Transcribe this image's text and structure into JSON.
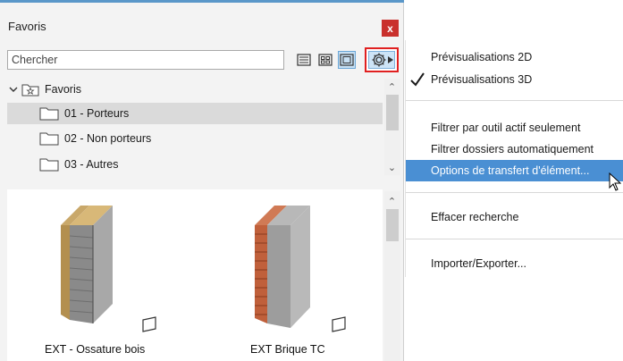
{
  "panel": {
    "title": "Favoris",
    "close_label": "x",
    "search": {
      "placeholder": "Chercher",
      "value": "Chercher"
    }
  },
  "tree": {
    "root": "Favoris",
    "folders": [
      {
        "label": "01 - Porteurs",
        "selected": true
      },
      {
        "label": "02 - Non porteurs",
        "selected": false
      },
      {
        "label": "03 - Autres",
        "selected": false
      }
    ]
  },
  "gallery": {
    "items": [
      {
        "label": "EXT - Ossature bois"
      },
      {
        "label": "EXT Brique TC"
      }
    ]
  },
  "menu": {
    "items": [
      {
        "label": "Prévisualisations 2D",
        "checked": false
      },
      {
        "label": "Prévisualisations 3D",
        "checked": true
      },
      {
        "label": "Filtrer par outil actif seulement"
      },
      {
        "label": "Filtrer dossiers automatiquement"
      },
      {
        "label": "Options de transfert d'élément...",
        "highlighted": true
      },
      {
        "label": "Effacer recherche"
      },
      {
        "label": "Importer/Exporter..."
      }
    ]
  },
  "colors": {
    "close": "#c9302c",
    "highlight": "#4a8fd3",
    "gear_outline": "#e02020",
    "selection": "#dadada"
  },
  "icons": [
    "list-view-icon",
    "grid-view-icon",
    "preview-view-icon",
    "gear-icon",
    "folder-icon",
    "star-folder-icon",
    "checkmark-icon",
    "cursor-icon"
  ]
}
